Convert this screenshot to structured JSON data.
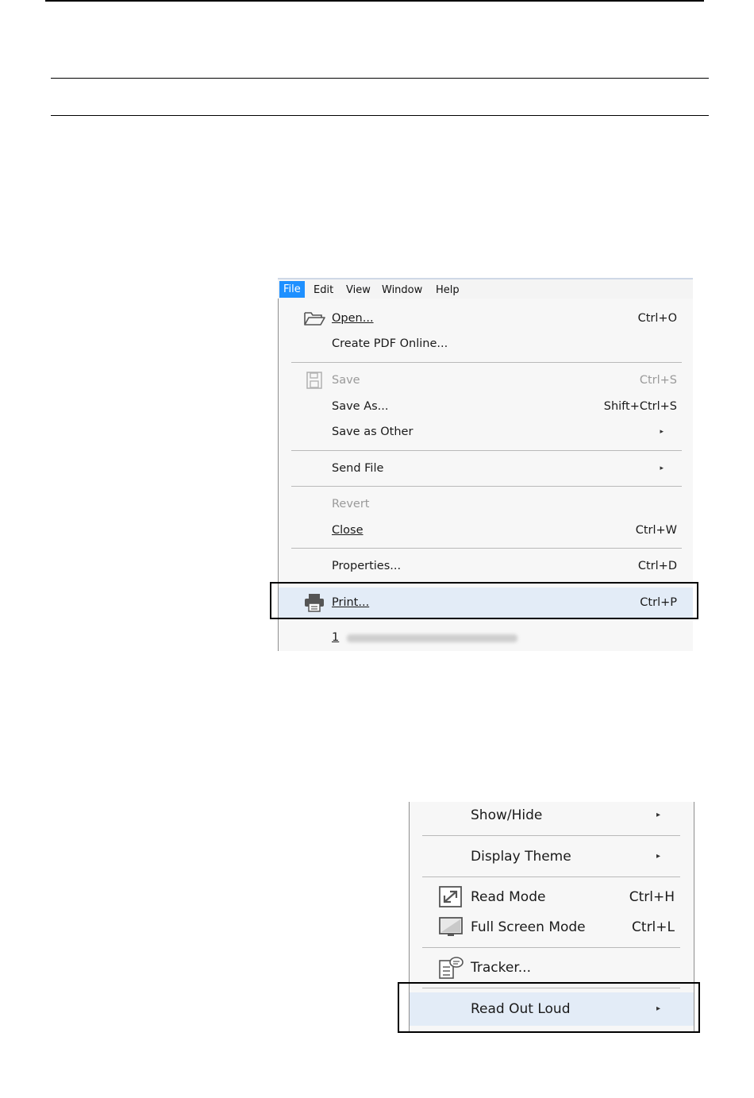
{
  "file_menu": {
    "menubar": [
      "File",
      "Edit",
      "View",
      "Window",
      "Help"
    ],
    "items": {
      "open": {
        "label": "Open...",
        "shortcut": "Ctrl+O",
        "icon": "folder-open-icon"
      },
      "create_pdf": {
        "label": "Create PDF Online..."
      },
      "save": {
        "label": "Save",
        "shortcut": "Ctrl+S",
        "icon": "save-icon",
        "disabled": true
      },
      "save_as": {
        "label": "Save As...",
        "shortcut": "Shift+Ctrl+S"
      },
      "save_other": {
        "label": "Save as Other",
        "submenu": "▸"
      },
      "send_file": {
        "label": "Send File",
        "submenu": "▸"
      },
      "revert": {
        "label": "Revert",
        "disabled": true
      },
      "close": {
        "label": "Close",
        "shortcut": "Ctrl+W"
      },
      "properties": {
        "label": "Properties...",
        "shortcut": "Ctrl+D"
      },
      "print": {
        "label": "Print...",
        "shortcut": "Ctrl+P",
        "icon": "printer-icon",
        "highlighted": true
      },
      "recent": {
        "label": "1"
      }
    }
  },
  "view_menu": {
    "items": {
      "show_hide": {
        "label": "Show/Hide",
        "submenu": "▸"
      },
      "display_theme": {
        "label": "Display Theme",
        "submenu": "▸"
      },
      "read_mode": {
        "label": "Read Mode",
        "shortcut": "Ctrl+H",
        "icon": "read-mode-icon"
      },
      "full_screen": {
        "label": "Full Screen Mode",
        "shortcut": "Ctrl+L",
        "icon": "monitor-icon"
      },
      "tracker": {
        "label": "Tracker...",
        "icon": "tracker-icon"
      },
      "read_out_loud": {
        "label": "Read Out Loud",
        "submenu": "▸",
        "highlighted": true
      }
    }
  },
  "colors": {
    "active_menu": "#1e90ff",
    "highlight": "#e3ecf7",
    "callout": "#000000"
  }
}
